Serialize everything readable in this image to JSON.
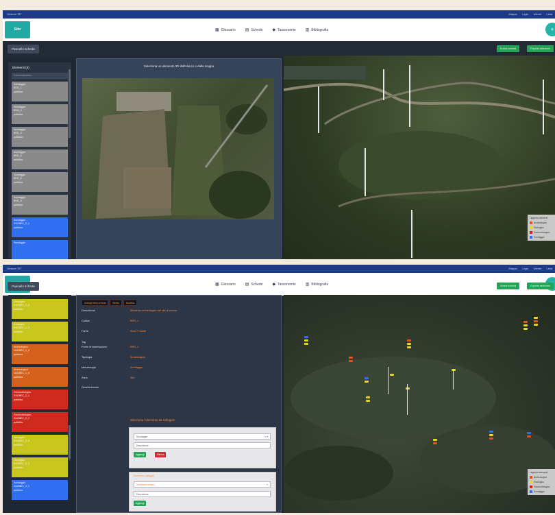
{
  "top_strip": {
    "left": "Gestore SIT",
    "right": "Mappa Login Utente Lista"
  },
  "navbar": {
    "logo": "Sito",
    "menu": [
      {
        "icon": "book-icon",
        "glyph": "▦",
        "label": "Glossario"
      },
      {
        "icon": "grid-icon",
        "glyph": "▤",
        "label": "Schede"
      },
      {
        "icon": "tag-icon",
        "glyph": "◆",
        "label": "Tassonomie"
      },
      {
        "icon": "bibliography-icon",
        "glyph": "▥",
        "label": "Bibliografia"
      }
    ],
    "round_button": "+"
  },
  "toolbar": {
    "panel_toggle": "Pannello schede",
    "green_left": "Nuova scheda",
    "green_right": "Esporta selezione"
  },
  "screen1": {
    "sidebar": {
      "title": "Elementi (8)",
      "search_placeholder": "Cerca elemento...",
      "items": [
        {
          "line1": "Sondaggio",
          "line2": "BSG_1",
          "line3": "pubblico",
          "color": "#8a8a8a"
        },
        {
          "line1": "Sondaggio",
          "line2": "BSG_2",
          "line3": "pubblico",
          "color": "#8a8a8a"
        },
        {
          "line1": "Sondaggio",
          "line2": "BSG_3",
          "line3": "pubblico",
          "color": "#8a8a8a"
        },
        {
          "line1": "Sondaggio",
          "line2": "BSG_4",
          "line3": "pubblico",
          "color": "#8a8a8a"
        },
        {
          "line1": "Sondaggio",
          "line2": "BSG_5",
          "line3": "pubblico",
          "color": "#8a8a8a"
        },
        {
          "line1": "Sondaggio",
          "line2": "BSG_6",
          "line3": "pubblico",
          "color": "#8a8a8a"
        },
        {
          "line1": "Sondaggio",
          "line2": "SAGBEC_2_1",
          "line3": "pubblico",
          "color": "#2f6ff0"
        },
        {
          "line1": "Sondaggio",
          "line2": "",
          "line3": "",
          "color": "#2f6ff0"
        }
      ]
    },
    "panel_title": "Seleziona un elemento 3D dall'elenco o dalla mappa",
    "legend": {
      "title": "Legenda elementi",
      "items": [
        {
          "label": "Archeologico",
          "color": "#e5531f"
        },
        {
          "label": "Geologico",
          "color": "#e9d61f"
        },
        {
          "label": "Geomorfologico",
          "color": "#d6281f"
        },
        {
          "label": "Sondaggio",
          "color": "#2f6ff0"
        }
      ]
    }
  },
  "screen2": {
    "sidebar": {
      "items": [
        {
          "line1": "Geologico",
          "line2": "SAGBEC_1_2",
          "line3": "pubblico",
          "color": "#c9c71c"
        },
        {
          "line1": "Geologico",
          "line2": "SAGBEC_1_3",
          "line3": "pubblico",
          "color": "#c9c71c"
        },
        {
          "line1": "Archeologico",
          "line2": "SAGBEC_1_4",
          "line3": "pubblico",
          "color": "#d5621c"
        },
        {
          "line1": "Archeologico",
          "line2": "SAGBEC_1_5",
          "line3": "pubblico",
          "color": "#d5621c"
        },
        {
          "line1": "Geomorfologico",
          "line2": "SAGBEC_2_1",
          "line3": "pubblico",
          "color": "#cf2a1e"
        },
        {
          "line1": "Geomorfologico",
          "line2": "SAGBEC_2_2",
          "line3": "pubblico",
          "color": "#cf2a1e"
        },
        {
          "line1": "Geologico",
          "line2": "SAGBEC_2_3",
          "line3": "pubblico",
          "color": "#c9c71c"
        },
        {
          "line1": "Geologico",
          "line2": "SAGBEC_2_4",
          "line3": "pubblico",
          "color": "#c9c71c"
        },
        {
          "line1": "Sondaggio",
          "line2": "SAGBEC_3_1",
          "line3": "pubblico",
          "color": "#2f6ff0"
        }
      ]
    },
    "tabs": [
      "Dettagli della scheda",
      "Media",
      "Modifica"
    ],
    "fields": [
      {
        "label": "Descrizione",
        "value": "Elemento archeologico del sito di ricerca"
      },
      {
        "label": "Codice",
        "value": "BSG_1"
      },
      {
        "label": "Fonte",
        "value": "Scavi Fumetti"
      },
      {
        "label": "Tag",
        "value": ""
      },
      {
        "label": "Punto di osservazione",
        "value": "BSG_1"
      },
      {
        "label": "Tipologia",
        "value": "Archeologico"
      },
      {
        "label": "Metodologia",
        "value": "Sondaggio"
      },
      {
        "label": "Zona",
        "value": "Sito"
      },
      {
        "label": "Georiferimento",
        "value": ""
      }
    ],
    "relation_header": "Seleziona l'elemento da collegare",
    "box1": {
      "select_value": "Sondaggio",
      "select_arrow": "× ▾",
      "input_placeholder": "Descrizione",
      "btn_add": "Aggiungi",
      "btn_remove": "Elimina"
    },
    "box2": {
      "title": "Elementi collegati",
      "select_value": "Seleziona un tipo...",
      "input_placeholder": "Descrizione",
      "btn_add": "Aggiungi"
    },
    "legend": {
      "title": "Legenda elementi",
      "items": [
        {
          "label": "Archeologico",
          "color": "#e5531f"
        },
        {
          "label": "Geologico",
          "color": "#e9d61f"
        },
        {
          "label": "Geomorfologico",
          "color": "#d6281f"
        },
        {
          "label": "Sondaggio",
          "color": "#2f6ff0"
        }
      ]
    }
  }
}
